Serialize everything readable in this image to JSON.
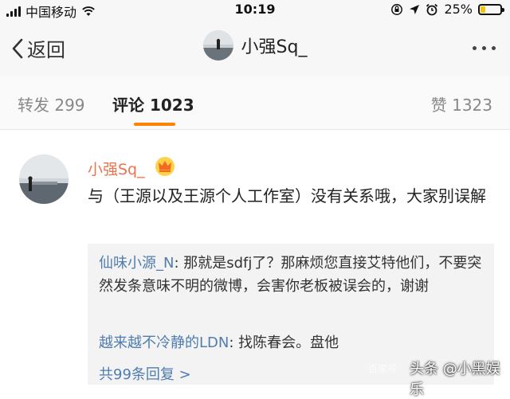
{
  "status_bar": {
    "carrier": "中国移动",
    "time": "10:19",
    "battery_percent_text": "25%",
    "battery_level": 0.25
  },
  "navbar": {
    "back_label": "返回",
    "title": "小强Sq_"
  },
  "tabs": [
    {
      "label": "转发 299"
    },
    {
      "label": "评论 1023"
    },
    {
      "label": "赞 1323"
    }
  ],
  "comment": {
    "username": "小强Sq_",
    "text": "与（王源以及王源个人工作室）没有关系哦，大家别误解"
  },
  "replies": [
    {
      "name": "仙味小源_N",
      "text": ": 那就是sdfj了？那麻烦您直接艾特他们，不要突然发条意味不明的微博，会害你老板被误会的，谢谢"
    },
    {
      "name": "越来越不冷静的LDN",
      "text": ": 找陈春会。盘他"
    }
  ],
  "more_replies_label": "共99条回复 >",
  "overlay": {
    "watermark": "百家号",
    "source_tag": "头条 @小黑娱乐"
  },
  "colors": {
    "accent_orange": "#ff8200",
    "username_orange": "#eb7350",
    "reply_blue": "#507daf"
  }
}
